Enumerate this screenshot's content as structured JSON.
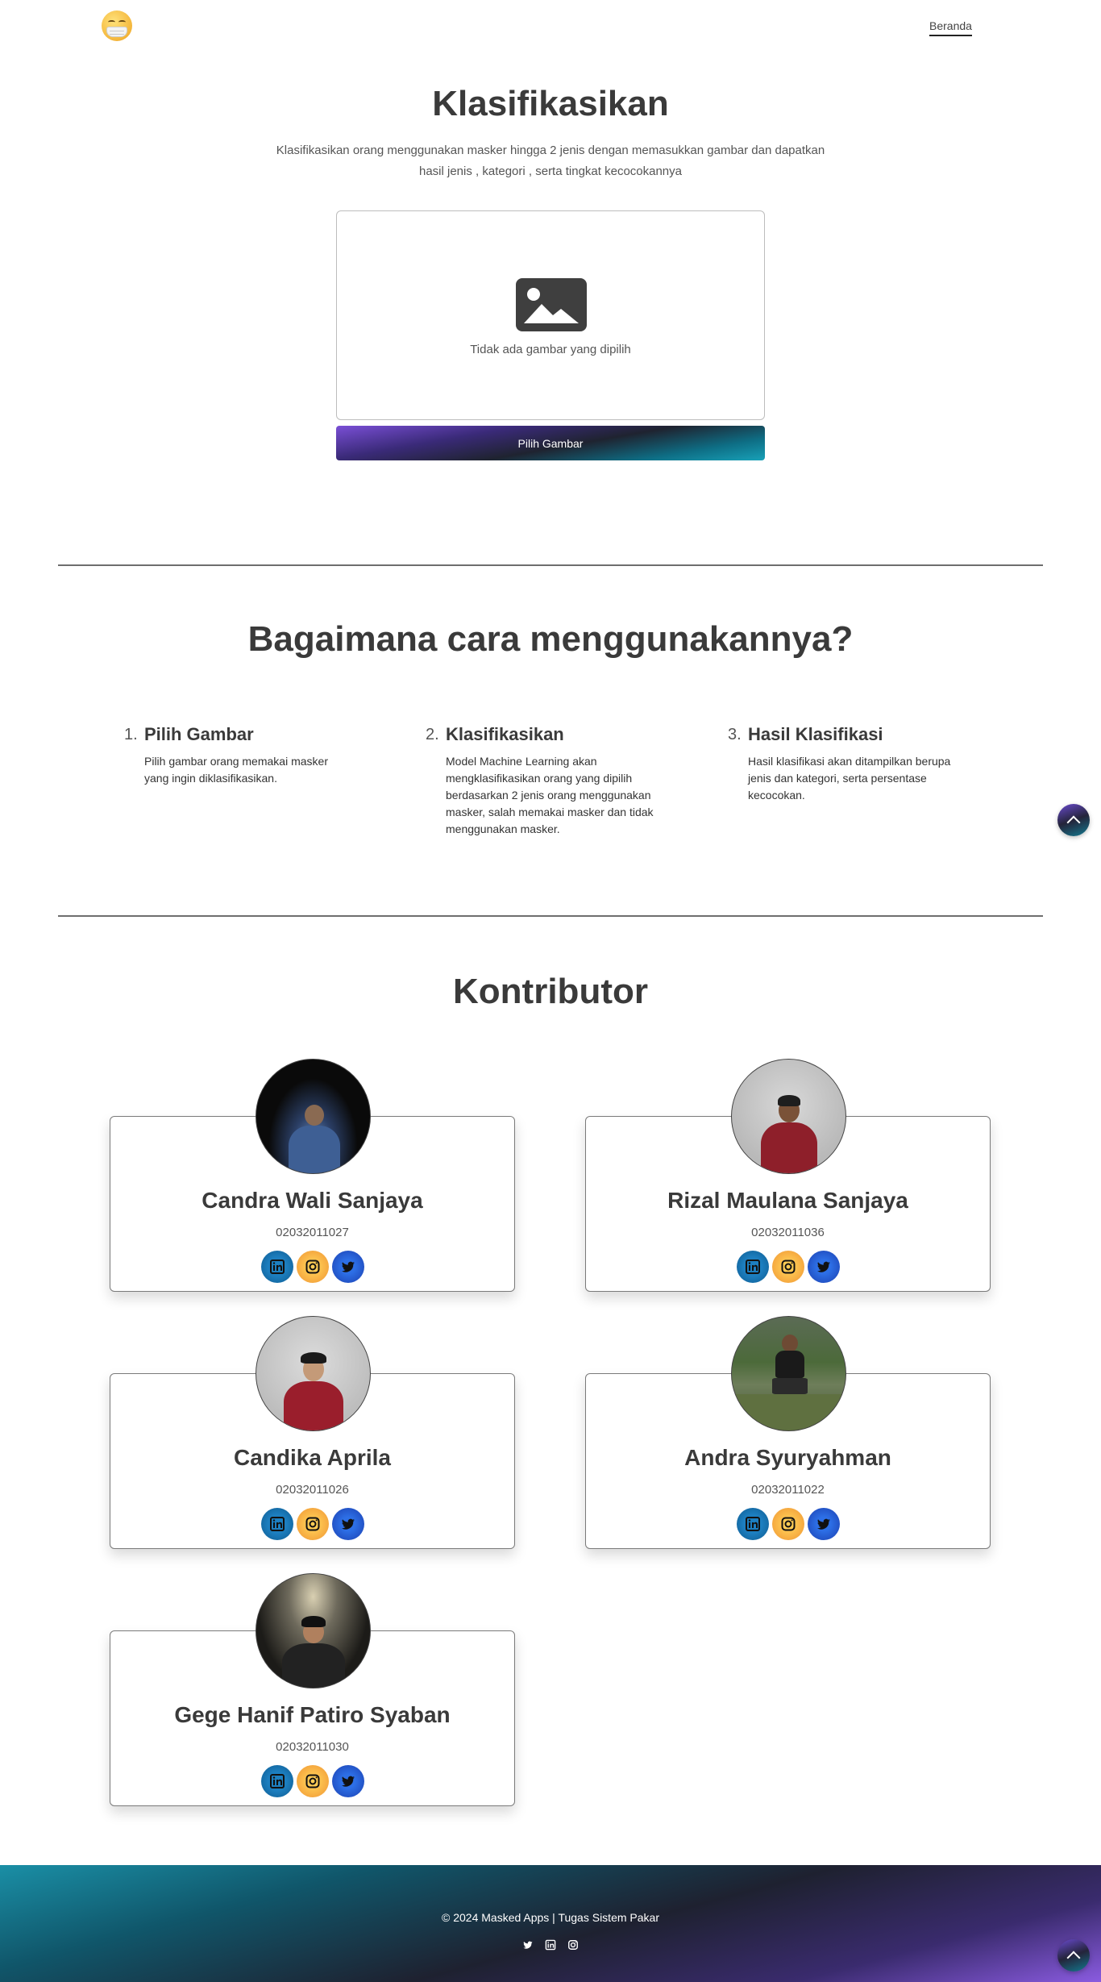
{
  "nav": {
    "logo": "masked-face-logo",
    "link": "Beranda"
  },
  "hero": {
    "title": "Klasifikasikan",
    "description": "Klasifikasikan orang menggunakan masker hingga 2 jenis dengan memasukkan gambar dan dapatkan hasil jenis , kategori , serta tingkat kecocokannya",
    "empty_text": "Tidak ada gambar yang dipilih",
    "button": "Pilih Gambar"
  },
  "howto": {
    "title": "Bagaimana cara menggunakannya?",
    "steps": [
      {
        "num": "1.",
        "title": "Pilih Gambar",
        "text": "Pilih gambar orang memakai masker yang ingin diklasifikasikan."
      },
      {
        "num": "2.",
        "title": "Klasifikasikan",
        "text": "Model Machine Learning akan mengklasifikasikan orang yang dipilih berdasarkan 2 jenis orang menggunakan masker, salah memakai masker dan tidak menggunakan masker."
      },
      {
        "num": "3.",
        "title": "Hasil Klasifikasi",
        "text": "Hasil klasifikasi akan ditampilkan berupa jenis dan kategori, serta persentase kecocokan."
      }
    ]
  },
  "contributors": {
    "title": "Kontributor",
    "people": [
      {
        "name": "Candra Wali Sanjaya",
        "nim": "02032011027"
      },
      {
        "name": "Rizal Maulana Sanjaya",
        "nim": "02032011036"
      },
      {
        "name": "Candika Aprila",
        "nim": "02032011026"
      },
      {
        "name": "Andra Syuryahman",
        "nim": "02032011022"
      },
      {
        "name": "Gege Hanif Patiro Syaban",
        "nim": "02032011030"
      }
    ]
  },
  "footer": {
    "copyright": "© 2024 Masked Apps | Tugas Sistem Pakar"
  },
  "colors": {
    "accent_start": "#7a4fd6",
    "accent_end": "#18a1b8",
    "text": "#3a3a3a"
  }
}
